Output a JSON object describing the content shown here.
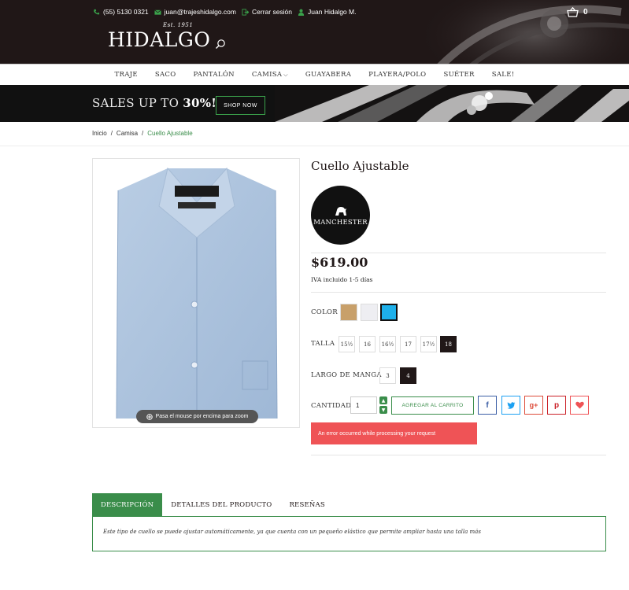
{
  "header": {
    "phone": "(55) 5130 0321",
    "email": "juan@trajeshidalgo.com",
    "logout": "Cerrar sesión",
    "user": "Juan Hidalgo M.",
    "logo": "HIDALGO",
    "logo_est": "Est. 1951",
    "cart_count": "0"
  },
  "nav": {
    "items": [
      "TRAJE",
      "SACO",
      "PANTALÓN",
      "CAMISA",
      "GUAYABERA",
      "PLAYERA/POLO",
      "SUÉTER",
      "SALE!"
    ]
  },
  "promo": {
    "text_prefix": "SALES UP TO",
    "text_value": "30%!",
    "button": "SHOP NOW"
  },
  "breadcrumb": {
    "home": "Inicio",
    "category": "Camisa",
    "current": "Cuello Ajustable",
    "sep": "/"
  },
  "product": {
    "title": "Cuello Ajustable",
    "brand": "MANCHESTER",
    "price": "$619.00",
    "tax_note": "IVA incluido 1-5 días",
    "zoom_hint": "Pasa el mouse por encima para zoom",
    "color_label": "COLOR",
    "colors": [
      "#c8a06a",
      "#eeeef2",
      "#1eb0ea"
    ],
    "size_label": "TALLA",
    "sizes": [
      "15½",
      "16",
      "16½",
      "17",
      "17½",
      "18"
    ],
    "selected_size": "18",
    "sleeve_label": "LARGO DE MANGA",
    "sleeves": [
      "3",
      "4"
    ],
    "selected_sleeve": "4",
    "qty_label": "CANTIDAD",
    "qty_value": "1",
    "add_to_cart": "AGREGAR AL CARRITO",
    "error": "An error occurred while processing your request"
  },
  "tabs": {
    "items": [
      "DESCRIPCIÓN",
      "DETALLES DEL PRODUCTO",
      "RESEÑAS"
    ],
    "description": "Este tipo de cuello se puede ajustar automáticamente, ya que cuenta con un pequeño elástico que permite ampliar hasta una talla más"
  },
  "colors": {
    "header_bg": "#201717",
    "accent_green": "#3a8d4a",
    "error_red": "#ef5356"
  }
}
